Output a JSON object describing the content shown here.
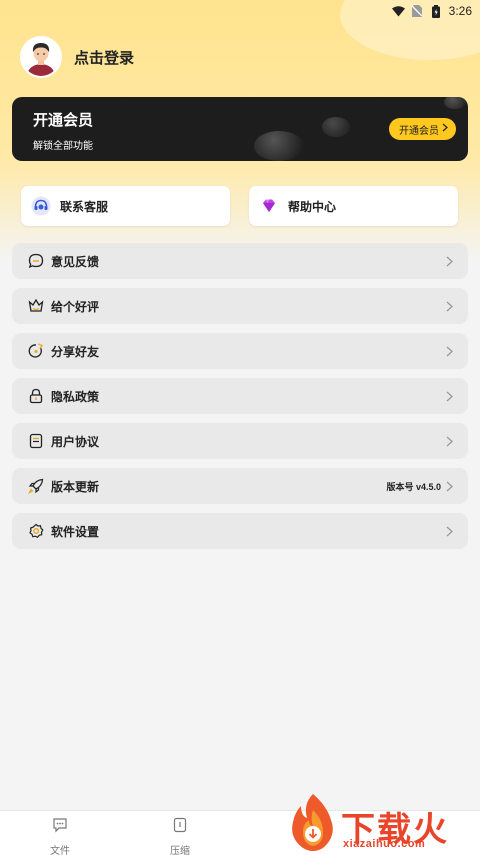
{
  "status_bar": {
    "time": "3:26"
  },
  "profile": {
    "login_label": "点击登录"
  },
  "vip": {
    "title": "开通会员",
    "subtitle": "解锁全部功能",
    "button_label": "开通会员"
  },
  "quick_actions": [
    {
      "label": "联系客服",
      "icon": "customer-service-icon"
    },
    {
      "label": "帮助中心",
      "icon": "help-diamond-icon"
    }
  ],
  "menu": [
    {
      "label": "意见反馈",
      "icon": "feedback-bubble-icon",
      "extra": ""
    },
    {
      "label": "给个好评",
      "icon": "rating-crown-icon",
      "extra": ""
    },
    {
      "label": "分享好友",
      "icon": "share-icon",
      "extra": ""
    },
    {
      "label": "隐私政策",
      "icon": "lock-icon",
      "extra": ""
    },
    {
      "label": "用户协议",
      "icon": "document-icon",
      "extra": ""
    },
    {
      "label": "版本更新",
      "icon": "rocket-icon",
      "extra": "版本号 v4.5.0"
    },
    {
      "label": "软件设置",
      "icon": "settings-gear-icon",
      "extra": ""
    }
  ],
  "tabbar": [
    {
      "label": "文件",
      "icon": "file-chat-icon"
    },
    {
      "label": "压缩",
      "icon": "compress-icon"
    }
  ],
  "watermark": {
    "text": "下载火",
    "url": "xiazaihuo.com"
  },
  "colors": {
    "accent": "#ffc81e",
    "card_dark": "#1d1d1d",
    "header_bg": "#ffe38e",
    "watermark": "#e8452a"
  }
}
